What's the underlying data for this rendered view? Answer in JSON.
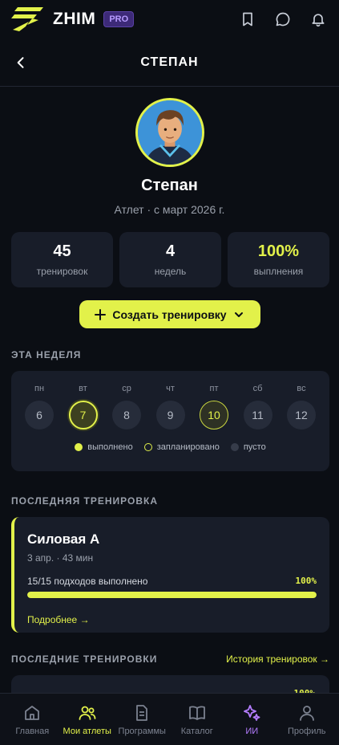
{
  "header": {
    "brand": "ZHIM",
    "badge": "PRO"
  },
  "nav": {
    "title": "СТЕПАН"
  },
  "profile": {
    "name": "Степан",
    "subtitle": "Атлет · с март 2026 г."
  },
  "stats": [
    {
      "value": "45",
      "label": "тренировок"
    },
    {
      "value": "4",
      "label": "недель"
    },
    {
      "value": "100%",
      "label": "выплнения"
    }
  ],
  "create_button": "Создать тренировку",
  "week": {
    "title": "ЭТА НЕДЕЛЯ",
    "days": [
      {
        "name": "пн",
        "num": "6",
        "state": "empty"
      },
      {
        "name": "вт",
        "num": "7",
        "state": "done"
      },
      {
        "name": "ср",
        "num": "8",
        "state": "empty"
      },
      {
        "name": "чт",
        "num": "9",
        "state": "empty"
      },
      {
        "name": "пт",
        "num": "10",
        "state": "planned"
      },
      {
        "name": "сб",
        "num": "11",
        "state": "empty"
      },
      {
        "name": "вс",
        "num": "12",
        "state": "empty"
      }
    ],
    "legend": {
      "done": "выполнено",
      "planned": "запланировано",
      "empty": "пусто"
    }
  },
  "last_workout": {
    "section_title": "ПОСЛЕДНЯЯ ТРЕНИРОВКА",
    "name": "Силовая А",
    "meta": "3 апр. · 43 мин",
    "progress_text": "15/15 подходов выполнено",
    "progress_pct": "100%",
    "progress_value": 1.0,
    "more": "Подробнее →"
  },
  "recent": {
    "section_title": "ПОСЛЕДНИЕ ТРЕНИРОВКИ",
    "history_link": "История тренировок →",
    "first_pct": "100%"
  },
  "tabs": [
    {
      "label": "Главная",
      "icon": "home-icon"
    },
    {
      "label": "Мои атлеты",
      "icon": "users-icon"
    },
    {
      "label": "Программы",
      "icon": "document-icon"
    },
    {
      "label": "Каталог",
      "icon": "book-icon"
    },
    {
      "label": "ИИ",
      "icon": "sparkles-icon"
    },
    {
      "label": "Профиль",
      "icon": "user-icon"
    }
  ],
  "colors": {
    "accent": "#e2f14a",
    "ai": "#b47dff",
    "background": "#0b0e14",
    "card": "#181d29"
  }
}
